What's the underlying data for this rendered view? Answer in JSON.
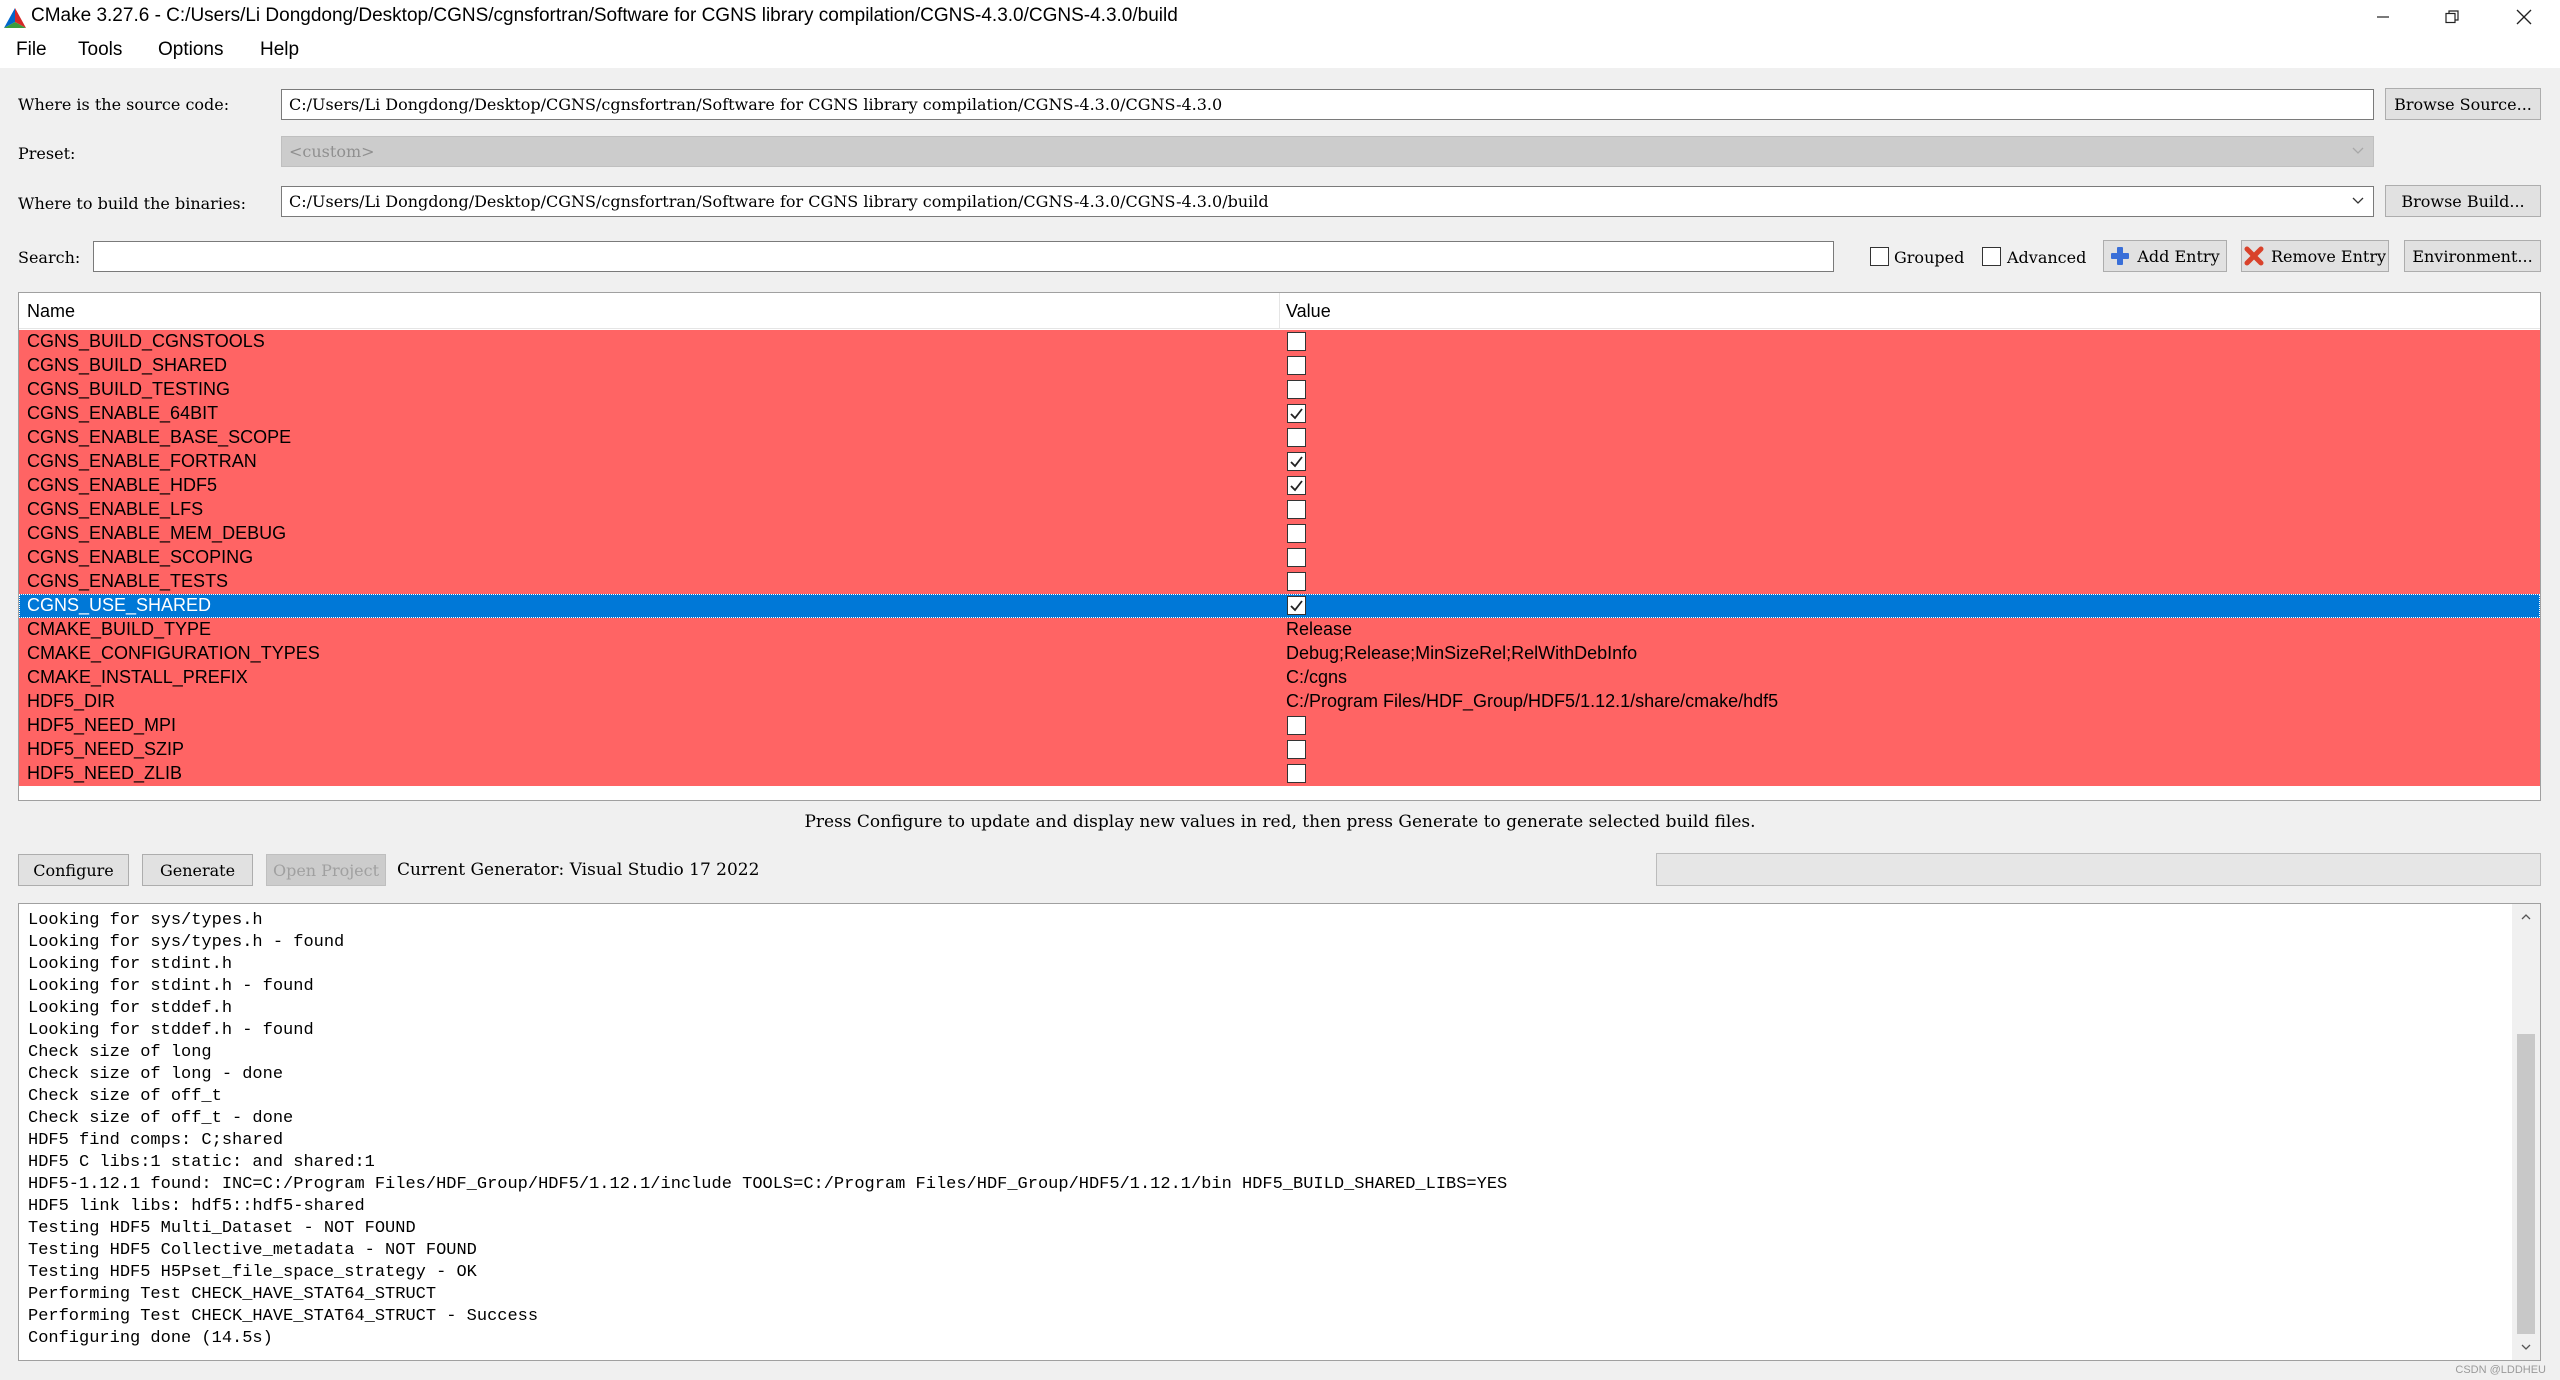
{
  "window": {
    "title": "CMake 3.27.6 - C:/Users/Li Dongdong/Desktop/CGNS/cgnsfortran/Software for CGNS library compilation/CGNS-4.3.0/CGNS-4.3.0/build",
    "icon": "cmake-triangle-icon"
  },
  "menu": [
    "File",
    "Tools",
    "Options",
    "Help"
  ],
  "source": {
    "label": "Where is the source code:",
    "value": "C:/Users/Li Dongdong/Desktop/CGNS/cgnsfortran/Software for CGNS library compilation/CGNS-4.3.0/CGNS-4.3.0",
    "button": "Browse Source..."
  },
  "preset": {
    "label": "Preset:",
    "value": "<custom>"
  },
  "build": {
    "label": "Where to build the binaries:",
    "value": "C:/Users/Li Dongdong/Desktop/CGNS/cgnsfortran/Software for CGNS library compilation/CGNS-4.3.0/CGNS-4.3.0/build",
    "button": "Browse Build..."
  },
  "search": {
    "label": "Search:",
    "value": "",
    "grouped_label": "Grouped",
    "grouped_checked": false,
    "advanced_label": "Advanced",
    "advanced_checked": false,
    "add_entry": "Add Entry",
    "remove_entry": "Remove Entry",
    "environment": "Environment..."
  },
  "table": {
    "headers": {
      "name": "Name",
      "value": "Value"
    },
    "colors": {
      "new_row": "#ff6464",
      "selected": "#0078d7"
    },
    "rows": [
      {
        "name": "CGNS_BUILD_CGNSTOOLS",
        "type": "bool",
        "checked": false
      },
      {
        "name": "CGNS_BUILD_SHARED",
        "type": "bool",
        "checked": false
      },
      {
        "name": "CGNS_BUILD_TESTING",
        "type": "bool",
        "checked": false
      },
      {
        "name": "CGNS_ENABLE_64BIT",
        "type": "bool",
        "checked": true
      },
      {
        "name": "CGNS_ENABLE_BASE_SCOPE",
        "type": "bool",
        "checked": false
      },
      {
        "name": "CGNS_ENABLE_FORTRAN",
        "type": "bool",
        "checked": true
      },
      {
        "name": "CGNS_ENABLE_HDF5",
        "type": "bool",
        "checked": true
      },
      {
        "name": "CGNS_ENABLE_LFS",
        "type": "bool",
        "checked": false
      },
      {
        "name": "CGNS_ENABLE_MEM_DEBUG",
        "type": "bool",
        "checked": false
      },
      {
        "name": "CGNS_ENABLE_SCOPING",
        "type": "bool",
        "checked": false
      },
      {
        "name": "CGNS_ENABLE_TESTS",
        "type": "bool",
        "checked": false
      },
      {
        "name": "CGNS_USE_SHARED",
        "type": "bool",
        "checked": true,
        "selected": true
      },
      {
        "name": "CMAKE_BUILD_TYPE",
        "type": "string",
        "value": "Release"
      },
      {
        "name": "CMAKE_CONFIGURATION_TYPES",
        "type": "string",
        "value": "Debug;Release;MinSizeRel;RelWithDebInfo"
      },
      {
        "name": "CMAKE_INSTALL_PREFIX",
        "type": "string",
        "value": "C:/cgns"
      },
      {
        "name": "HDF5_DIR",
        "type": "string",
        "value": "C:/Program Files/HDF_Group/HDF5/1.12.1/share/cmake/hdf5"
      },
      {
        "name": "HDF5_NEED_MPI",
        "type": "bool",
        "checked": false
      },
      {
        "name": "HDF5_NEED_SZIP",
        "type": "bool",
        "checked": false
      },
      {
        "name": "HDF5_NEED_ZLIB",
        "type": "bool",
        "checked": false
      }
    ]
  },
  "hint": "Press Configure to update and display new values in red, then press Generate to generate selected build files.",
  "actions": {
    "configure": "Configure",
    "generate": "Generate",
    "open_project": "Open Project",
    "generator": "Current Generator: Visual Studio 17 2022"
  },
  "log": [
    "Looking for sys/types.h",
    "Looking for sys/types.h - found",
    "Looking for stdint.h",
    "Looking for stdint.h - found",
    "Looking for stddef.h",
    "Looking for stddef.h - found",
    "Check size of long",
    "Check size of long - done",
    "Check size of off_t",
    "Check size of off_t - done",
    "HDF5 find comps: C;shared",
    "HDF5 C libs:1 static: and shared:1",
    "HDF5-1.12.1 found: INC=C:/Program Files/HDF_Group/HDF5/1.12.1/include TOOLS=C:/Program Files/HDF_Group/HDF5/1.12.1/bin HDF5_BUILD_SHARED_LIBS=YES",
    "HDF5 link libs: hdf5::hdf5-shared",
    "Testing HDF5 Multi_Dataset - NOT FOUND",
    "Testing HDF5 Collective_metadata - NOT FOUND",
    "Testing HDF5 H5Pset_file_space_strategy - OK",
    "Performing Test CHECK_HAVE_STAT64_STRUCT",
    "Performing Test CHECK_HAVE_STAT64_STRUCT - Success",
    "Configuring done (14.5s)"
  ],
  "watermark": "CSDN @LDDHEU"
}
